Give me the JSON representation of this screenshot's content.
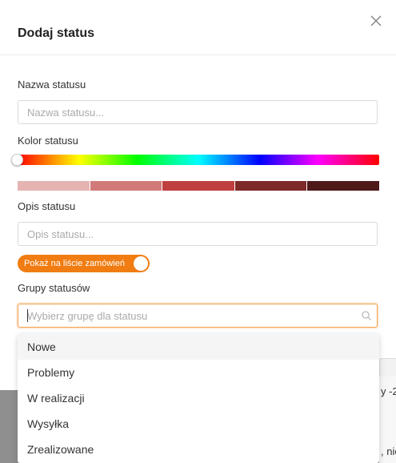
{
  "modal": {
    "title": "Dodaj status",
    "name_label": "Nazwa statusu",
    "name_placeholder": "Nazwa statusu...",
    "color_label": "Kolor statusu",
    "hue": 0,
    "swatches": [
      "#e6b3b3",
      "#d27a7a",
      "#bf3f3f",
      "#7f2a2a",
      "#4d1919"
    ],
    "description_label": "Opis statusu",
    "description_placeholder": "Opis statusu...",
    "toggle_label": "Pokaż na liście zamówień",
    "toggle_on": true,
    "groups_label": "Grupy statusów",
    "groups_placeholder": "Wybierz grupę dla statusu",
    "dropdown_options": [
      "Nowe",
      "Problemy",
      "W realizacji",
      "Wysyłka",
      "Zrealizowane"
    ]
  },
  "background": {
    "text1": "y -2",
    "text2": ", nie"
  },
  "colors": {
    "accent": "#f07c12"
  }
}
